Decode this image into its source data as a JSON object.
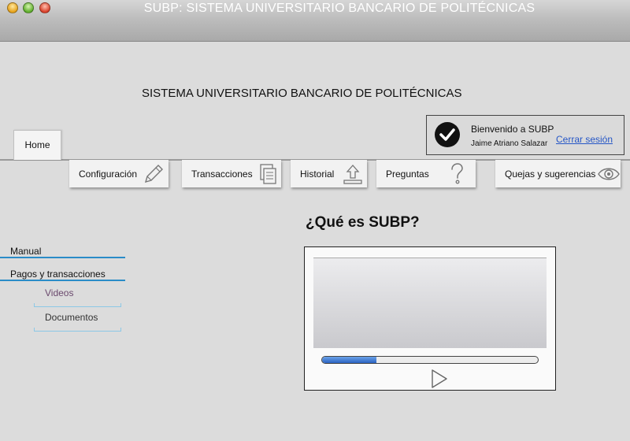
{
  "window": {
    "title": "SUBP: SISTEMA UNIVERSITARIO BANCARIO DE POLITÉCNICAS"
  },
  "app": {
    "heading": "SISTEMA UNIVERSITARIO BANCARIO DE POLITÉCNICAS"
  },
  "welcome": {
    "greeting": "Bienvenido a SUBP",
    "user_name": "Jaime Atriano Salazar",
    "logout_label": "Cerrar sesión"
  },
  "tabs": {
    "home_label": "Home"
  },
  "nav": {
    "buttons": [
      {
        "label": "Configuración",
        "icon": "pencil-icon"
      },
      {
        "label": "Transacciones",
        "icon": "documents-icon"
      },
      {
        "label": "Historial",
        "icon": "upload-icon"
      },
      {
        "label": "Preguntas",
        "icon": "question-icon"
      },
      {
        "label": "Quejas y sugerencias",
        "icon": "eye-icon"
      }
    ]
  },
  "sidebar": {
    "items": [
      {
        "label": "Manual"
      },
      {
        "label": "Pagos y transacciones"
      }
    ],
    "subitems": [
      {
        "label": "Videos"
      },
      {
        "label": "Documentos"
      }
    ]
  },
  "content": {
    "title": "¿Qué es SUBP?",
    "video": {
      "progress_percent": 25
    }
  },
  "colors": {
    "accent": "#2a8cc8",
    "link": "#2556c6",
    "active_subitem": "#6b4a6e"
  }
}
